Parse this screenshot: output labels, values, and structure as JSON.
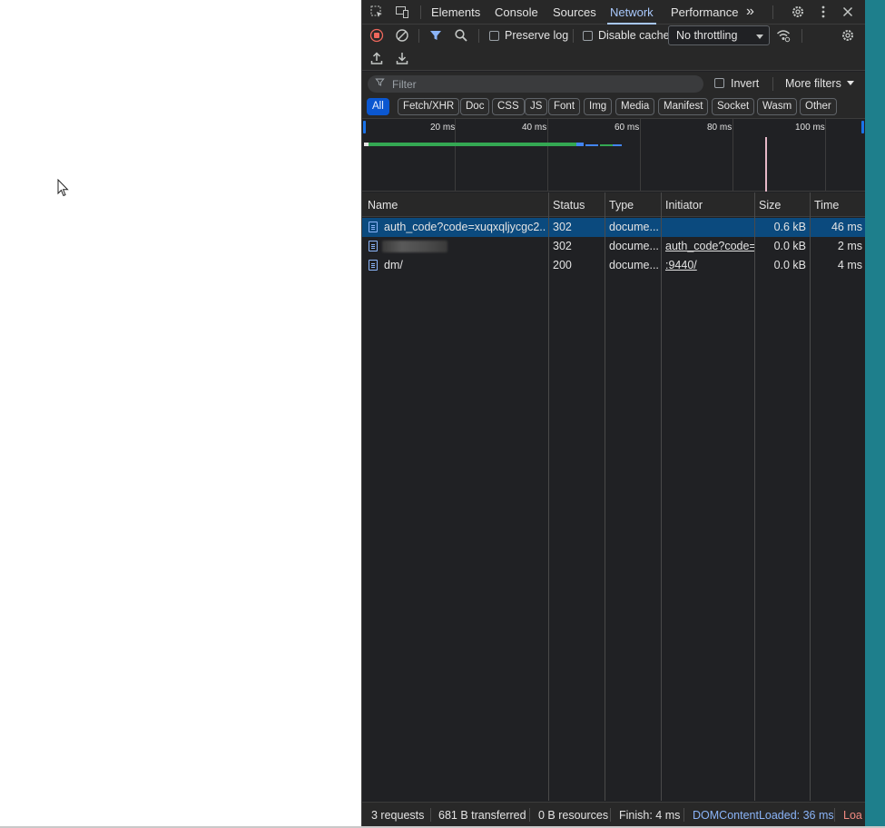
{
  "tabs": {
    "elements": "Elements",
    "console": "Console",
    "sources": "Sources",
    "network": "Network",
    "performance": "Performance",
    "more": "»"
  },
  "toolbar": {
    "preserve_log": "Preserve log",
    "disable_cache": "Disable cache",
    "throttling": "No throttling"
  },
  "filter": {
    "placeholder": "Filter",
    "invert": "Invert",
    "more_filters": "More filters"
  },
  "chips": [
    "All",
    "Fetch/XHR",
    "Doc",
    "CSS",
    "JS",
    "Font",
    "Img",
    "Media",
    "Manifest",
    "Socket",
    "Wasm",
    "Other"
  ],
  "overview": {
    "ticks": [
      "20 ms",
      "40 ms",
      "60 ms",
      "80 ms",
      "100 ms"
    ]
  },
  "columns": {
    "name": "Name",
    "status": "Status",
    "type": "Type",
    "initiator": "Initiator",
    "size": "Size",
    "time": "Time"
  },
  "rows": [
    {
      "name": "auth_code?code=xuqxqljycgc2...",
      "status": "302",
      "type": "docume...",
      "initiator": "",
      "size": "0.6 kB",
      "time": "46 ms"
    },
    {
      "name": "",
      "status": "302",
      "type": "docume...",
      "initiator": "auth_code?code=x",
      "size": "0.0 kB",
      "time": "2 ms"
    },
    {
      "name": "dm/",
      "status": "200",
      "type": "docume...",
      "initiator": ":9440/",
      "size": "0.0 kB",
      "time": "4 ms"
    }
  ],
  "status": {
    "requests": "3 requests",
    "transferred": "681 B transferred",
    "resources": "0 B resources",
    "finish": "Finish: 4 ms",
    "dom_content_loaded": "DOMContentLoaded: 36 ms",
    "load": "Loa"
  }
}
